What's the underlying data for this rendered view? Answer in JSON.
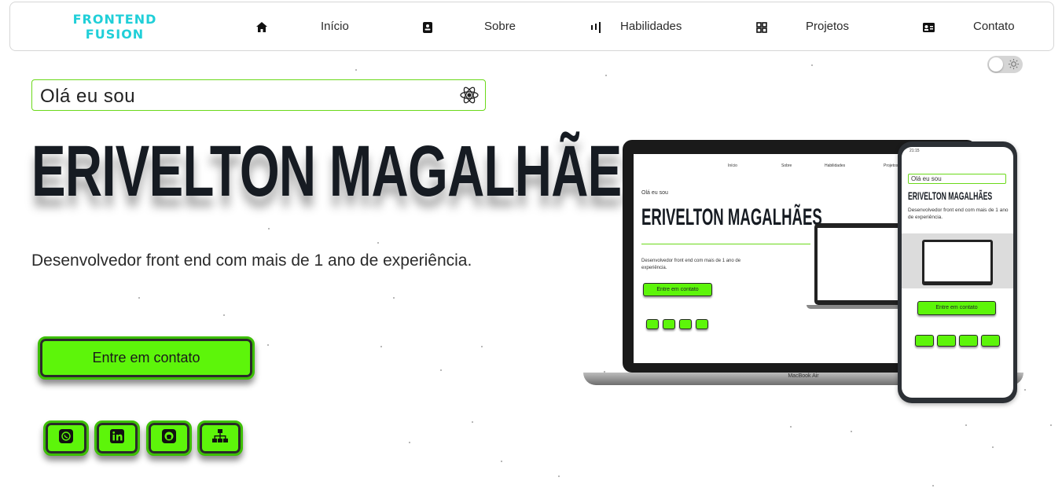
{
  "brand": {
    "line1": "FRONTEND",
    "line2": "FUSION",
    "color": "#20cfd8"
  },
  "nav": [
    {
      "label": "Início",
      "icon": "home-icon"
    },
    {
      "label": "Sobre",
      "icon": "contact-book-icon"
    },
    {
      "label": "Habilidades",
      "icon": "bars-icon"
    },
    {
      "label": "Projetos",
      "icon": "grid-icon"
    },
    {
      "label": "Contato",
      "icon": "id-card-icon"
    }
  ],
  "theme_toggle": {
    "icon": "sun-icon",
    "state": "light"
  },
  "hero": {
    "greeting": "Olá eu sou",
    "name": "ERIVELTON MAGALHÃES",
    "subtitle": "Desenvolvedor front end com mais de 1 ano de experiência.",
    "cta_label": "Entre em contato",
    "socials": [
      "whatsapp-icon",
      "linkedin-icon",
      "github-icon",
      "sitemap-icon"
    ],
    "accent_color": "#5df50a"
  },
  "mockup": {
    "laptop_brand": "MacBook Air",
    "nav": [
      "Início",
      "Sobre",
      "Habilidades",
      "Projetos"
    ],
    "greeting": "Olá eu sou",
    "name": "ERIVELTON MAGALHÃES",
    "subtitle": "Desenvolvedor front end com mais de 1 ano de experiência.",
    "cta_label": "Entre em contato",
    "phone_status_time": "21:15"
  }
}
